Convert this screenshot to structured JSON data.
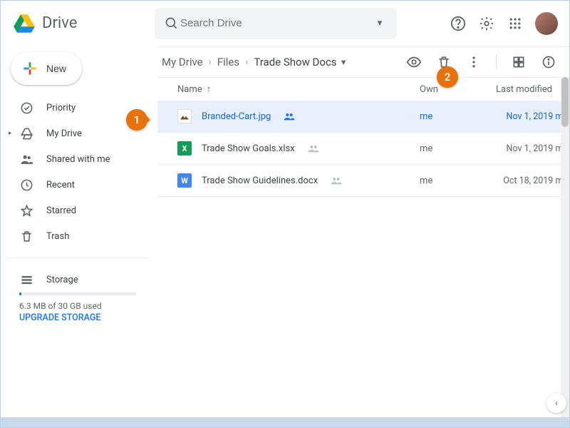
{
  "brand": "Drive",
  "search_placeholder": "Search Drive",
  "new_label": "New",
  "sidebar": {
    "items": [
      {
        "label": "Priority"
      },
      {
        "label": "My Drive"
      },
      {
        "label": "Shared with me"
      },
      {
        "label": "Recent"
      },
      {
        "label": "Starred"
      },
      {
        "label": "Trash"
      }
    ],
    "storage_label": "Storage",
    "storage_used": "6.3 MB of 30 GB used",
    "upgrade": "UPGRADE STORAGE"
  },
  "breadcrumbs": [
    "My Drive",
    "Files",
    "Trade Show Docs"
  ],
  "columns": {
    "name": "Name",
    "owner": "Own",
    "modified": "Last modified"
  },
  "files": [
    {
      "name": "Branded-Cart.jpg",
      "owner": "me",
      "modified": "Nov 1, 2019",
      "by": "me",
      "type": "img",
      "shared": true,
      "selected": true
    },
    {
      "name": "Trade Show Goals.xlsx",
      "owner": "me",
      "modified": "Nov 1, 2019",
      "by": "me",
      "type": "xlsx",
      "shared": true,
      "selected": false
    },
    {
      "name": "Trade Show Guidelines.docx",
      "owner": "me",
      "modified": "Oct 18, 2019",
      "by": "me",
      "type": "docx",
      "shared": true,
      "selected": false
    }
  ],
  "callouts": {
    "one": "1",
    "two": "2"
  }
}
